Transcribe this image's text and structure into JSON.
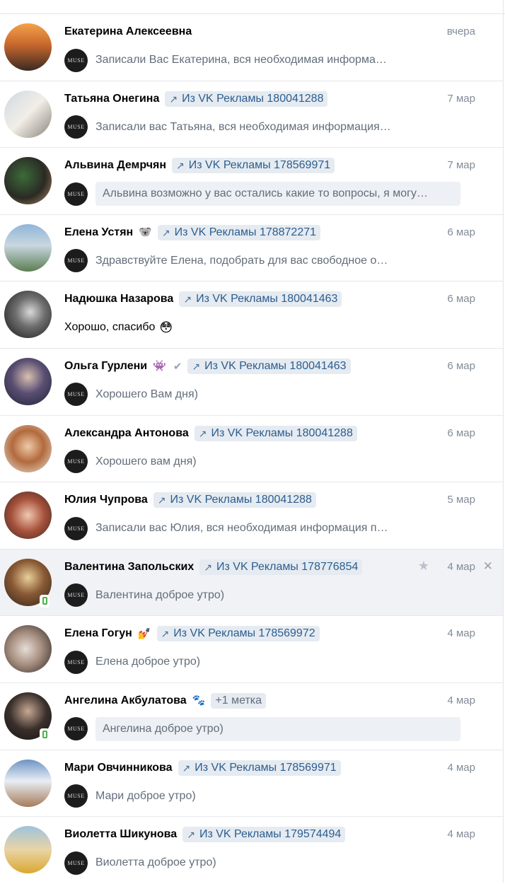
{
  "colors": {
    "tag_bg": "#e5ebf1",
    "tag_text": "#2c5d8f",
    "unread_bg": "#edf0f4",
    "selected_bg": "#f0f2f5",
    "online_green": "#4bb34b"
  },
  "sender_avatar": {
    "label": "MUSE"
  },
  "dialogs": [
    {
      "name": "Екатерина Алексеевна",
      "date": "вчера",
      "preview": "Записали Вас Екатерина, вся необходимая информа…"
    },
    {
      "name": "Татьяна Онегина",
      "tag": "Из VK Рекламы 180041288",
      "date": "7 мар",
      "preview": "Записали вас Татьяна, вся необходимая информация…"
    },
    {
      "name": "Альвина Демрчян",
      "tag": "Из VK Рекламы 178569971",
      "date": "7 мар",
      "preview": "Альвина возможно у вас остались какие то вопросы, я могу…"
    },
    {
      "name": "Елена Устян",
      "emoji": "🐨",
      "tag": "Из VK Рекламы 178872271",
      "date": "6 мар",
      "preview": "Здравствуйте Елена, подобрать для вас свободное о…"
    },
    {
      "name": "Надюшка Назарова",
      "tag": "Из VK Рекламы 180041463",
      "date": "6 мар",
      "preview": "Хорошо, спасибо",
      "preview_emoji": "😳"
    },
    {
      "name": "Ольга Гурлени",
      "emoji": "👾",
      "tag": "Из VK Рекламы 180041463",
      "date": "6 мар",
      "preview": "Хорошего Вам дня)"
    },
    {
      "name": "Александра Антонова",
      "tag": "Из VK Рекламы 180041288",
      "date": "6 мар",
      "preview": "Хорошего вам дня)"
    },
    {
      "name": "Юлия Чупрова",
      "tag": "Из VK Рекламы 180041288",
      "date": "5 мар",
      "preview": "Записали вас Юлия, вся необходимая информация п…"
    },
    {
      "name": "Валентина Запольских",
      "tag": "Из VK Рекламы 178776854",
      "date": "4 мар",
      "preview": "Валентина доброе утро)"
    },
    {
      "name": "Елена Гогун",
      "emoji": "💅",
      "tag": "Из VK Рекламы 178569972",
      "date": "4 мар",
      "preview": "Елена доброе утро)"
    },
    {
      "name": "Ангелина Акбулатова",
      "emoji": "🐾",
      "tag": "+1 метка",
      "date": "4 мар",
      "preview": "Ангелина доброе утро)"
    },
    {
      "name": "Мари Овчинникова",
      "tag": "Из VK Рекламы 178569971",
      "date": "4 мар",
      "preview": "Мари доброе утро)"
    },
    {
      "name": "Виолетта Шикунова",
      "tag": "Из VK Рекламы 179574494",
      "date": "4 мар",
      "preview": "Виолетта доброе утро)"
    }
  ]
}
